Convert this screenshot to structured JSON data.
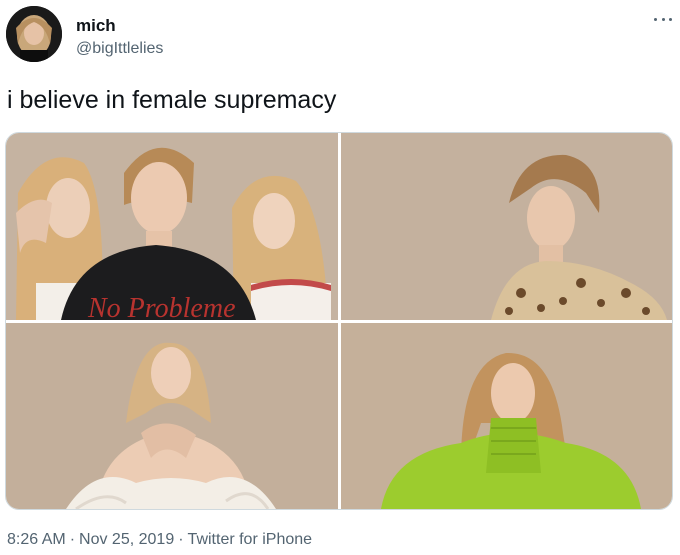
{
  "author": {
    "name": "mich",
    "handle": "@bigIttlelies"
  },
  "tweet": {
    "text": "i believe in female supremacy"
  },
  "photos": [
    {
      "shirt_text": "No Probleme"
    },
    {},
    {},
    {}
  ],
  "meta": {
    "time": "8:26 AM",
    "separator": "·",
    "date": "Nov 25, 2019",
    "source": "Twitter for iPhone"
  },
  "icons": {
    "more": "more-horizontal-icon"
  },
  "colors": {
    "text": "#0f1419",
    "secondary": "#536471",
    "border": "#cfd9de",
    "photo_backdrop": "#c2b09c",
    "green_jacket": "#9ccc2e"
  }
}
